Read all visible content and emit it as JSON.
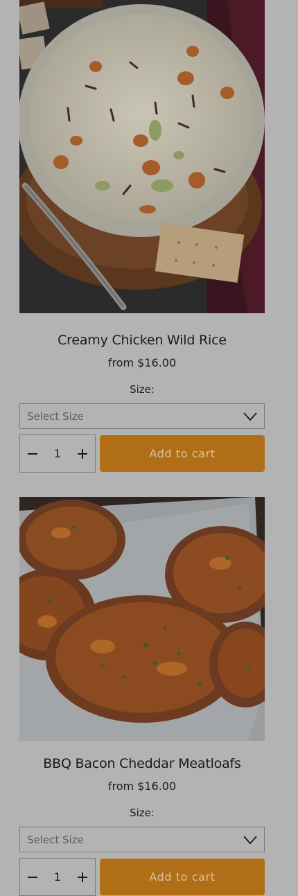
{
  "products": [
    {
      "name": "Creamy Chicken Wild Rice",
      "price": "from $16.00",
      "size_label": "Size:",
      "size_placeholder": "Select Size",
      "quantity": "1",
      "add_to_cart": "Add to cart"
    },
    {
      "name": "BBQ Bacon Cheddar Meatloafs",
      "price": "from $16.00",
      "size_label": "Size:",
      "size_placeholder": "Select Size",
      "quantity": "1",
      "add_to_cart": "Add to cart"
    }
  ],
  "colors": {
    "overlay_background": "#b3b3b3",
    "add_to_cart_button": "#b06f16",
    "border": "#7a7a7a"
  },
  "icons": {
    "select_chevron": "chevron-down-icon",
    "decrease": "minus-icon",
    "increase": "plus-icon"
  }
}
